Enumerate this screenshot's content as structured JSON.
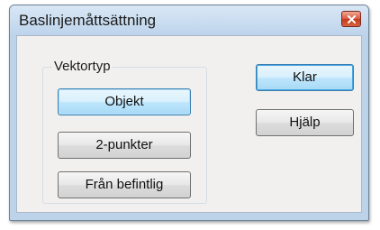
{
  "dialog": {
    "title": "Baslinjemåttsättning",
    "close_icon": "close-icon",
    "colors": {
      "close_button": "#c2391f",
      "selected_button": "#bee6fd",
      "frame": "#bcd3ea"
    }
  },
  "vector_group": {
    "label": "Vektortyp",
    "options": [
      {
        "label": "Objekt",
        "selected": true
      },
      {
        "label": "2-punkter",
        "selected": false
      },
      {
        "label": "Från befintlig",
        "selected": false
      }
    ]
  },
  "actions": {
    "done_label": "Klar",
    "help_label": "Hjälp"
  }
}
